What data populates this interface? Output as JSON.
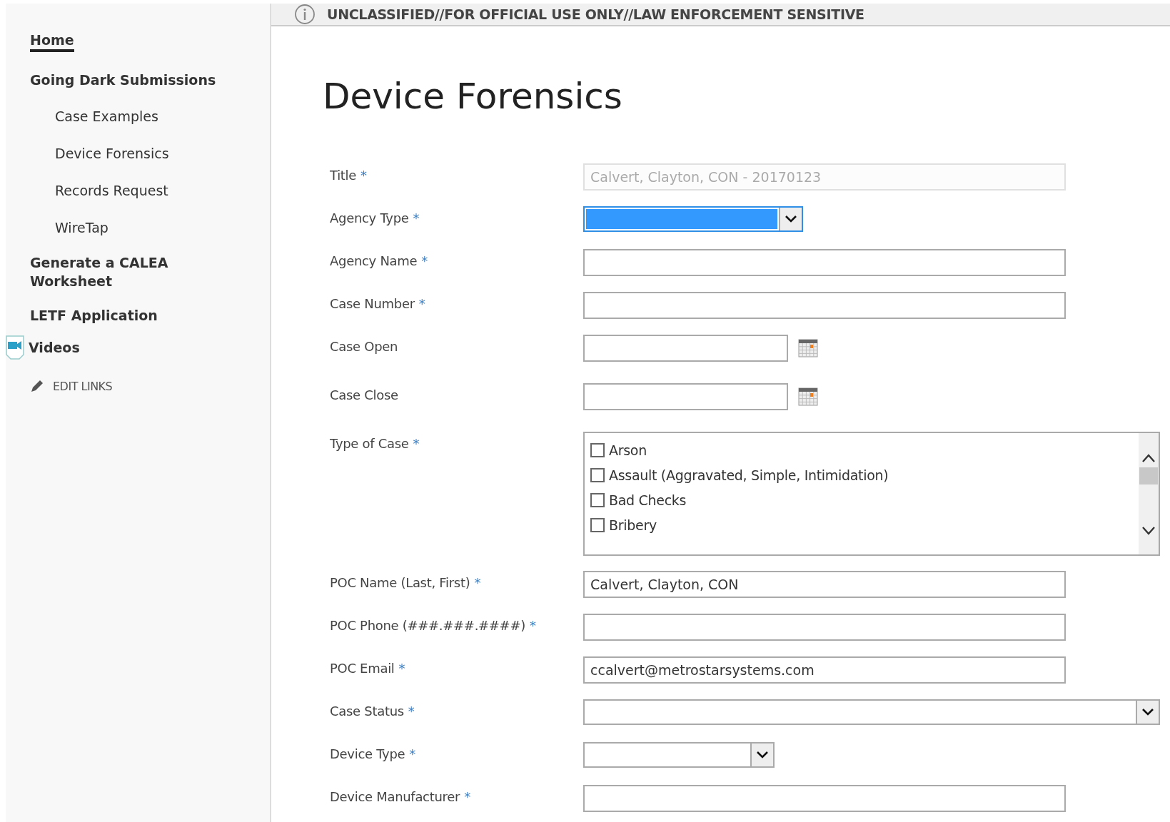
{
  "banner": {
    "text": "UNCLASSIFIED//FOR OFFICIAL USE ONLY//LAW ENFORCEMENT SENSITIVE"
  },
  "sidebar": {
    "items": [
      {
        "label": "Home",
        "selected": true,
        "kind": "link"
      },
      {
        "label": "Going Dark Submissions",
        "selected": false,
        "kind": "link",
        "children": [
          {
            "label": "Case Examples",
            "selected": false
          },
          {
            "label": "Device Forensics",
            "selected": false
          },
          {
            "label": "Records Request",
            "selected": false
          },
          {
            "label": "WireTap",
            "selected": false
          }
        ]
      },
      {
        "label": "Generate a CALEA Worksheet",
        "selected": false,
        "kind": "link"
      },
      {
        "label": "LETF Application",
        "selected": false,
        "kind": "link"
      },
      {
        "label": "Videos",
        "selected": false,
        "kind": "video"
      }
    ],
    "edit_links": "EDIT LINKS"
  },
  "page_title": "Device Forensics",
  "form": {
    "fields": [
      {
        "label": "Title",
        "required_mark": "*",
        "kind": "text",
        "value": "Calvert, Clayton, CON - 20170123",
        "disabled": true
      },
      {
        "label": "Agency Type",
        "required_mark": "*",
        "kind": "select",
        "highlighted": true
      },
      {
        "label": "Agency Name",
        "required_mark": "*",
        "kind": "text",
        "disabled": false
      },
      {
        "label": "Case Number",
        "required_mark": "*",
        "kind": "text",
        "disabled": false
      },
      {
        "label": "Case Open",
        "kind": "date"
      },
      {
        "label": "Case Close",
        "kind": "date"
      },
      {
        "label": "Type of Case",
        "required_mark": "*",
        "kind": "checklist",
        "options": [
          {
            "label": "Arson",
            "checked": false
          },
          {
            "label": "Assault (Aggravated, Simple, Intimidation)",
            "checked": false
          },
          {
            "label": "Bad Checks",
            "checked": false
          },
          {
            "label": "Bribery",
            "checked": false
          }
        ]
      },
      {
        "label": "POC Name (Last, First)",
        "required_mark": "*",
        "kind": "text",
        "value": "Calvert, Clayton, CON",
        "disabled": false
      },
      {
        "label": "POC Phone (###.###.####)",
        "required_mark": "*",
        "kind": "text",
        "disabled": false
      },
      {
        "label": "POC Email",
        "required_mark": "*",
        "kind": "text",
        "value": "ccalvert@metrostarsystems.com",
        "disabled": false
      },
      {
        "label": "Case Status",
        "required_mark": "*",
        "kind": "select",
        "highlighted": false
      },
      {
        "label": "Device Type",
        "required_mark": "*",
        "kind": "select",
        "highlighted": false
      },
      {
        "label": "Device Manufacturer",
        "required_mark": "*",
        "kind": "text",
        "disabled": false
      }
    ]
  }
}
